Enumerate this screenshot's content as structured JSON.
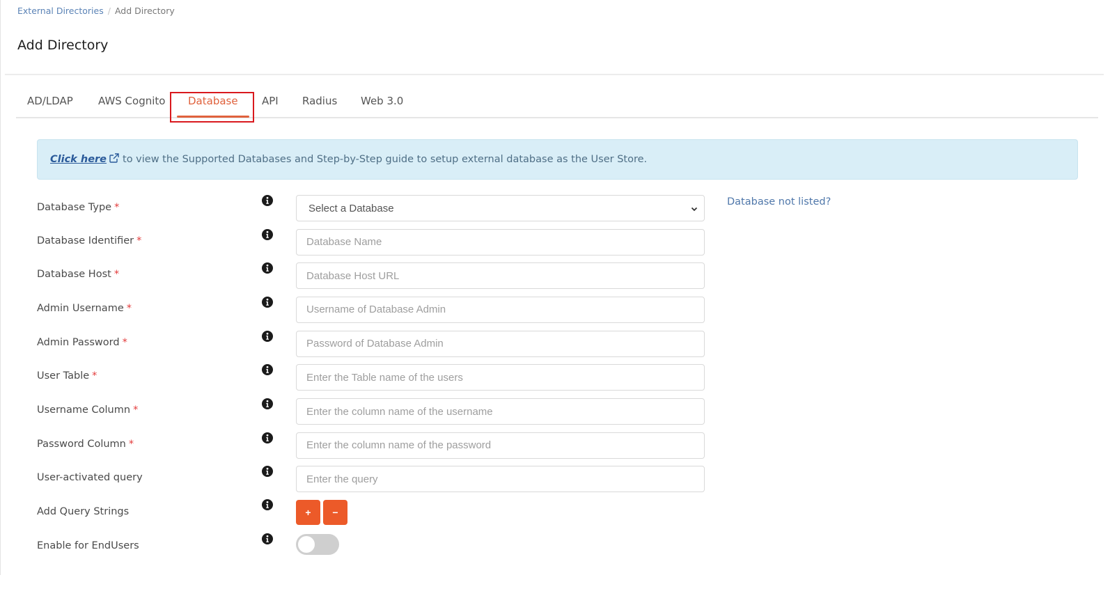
{
  "breadcrumb": {
    "items": [
      {
        "label": "External Directories"
      },
      {
        "label": "Add Directory"
      }
    ],
    "separator": "/"
  },
  "page": {
    "title": "Add Directory"
  },
  "tabs": [
    {
      "label": "AD/LDAP",
      "active": false
    },
    {
      "label": "AWS Cognito",
      "active": false
    },
    {
      "label": "Database",
      "active": true
    },
    {
      "label": "API",
      "active": false
    },
    {
      "label": "Radius",
      "active": false
    },
    {
      "label": "Web 3.0",
      "active": false
    }
  ],
  "banner": {
    "link_label": "Click here",
    "link_icon": "external-link-icon",
    "text": "to view the Supported Databases and Step-by-Step guide to setup external database as the User Store."
  },
  "form": {
    "database_type": {
      "label": "Database Type",
      "required": "*",
      "selected": "Select a Database",
      "side_link": "Database not listed?"
    },
    "fields": [
      {
        "label": "Database Identifier",
        "required": "*",
        "placeholder": "Database Name",
        "value": ""
      },
      {
        "label": "Database Host",
        "required": "*",
        "placeholder": "Database Host URL",
        "value": ""
      },
      {
        "label": "Admin Username",
        "required": "*",
        "placeholder": "Username of Database Admin",
        "value": ""
      },
      {
        "label": "Admin Password",
        "required": "*",
        "placeholder": "Password of Database Admin",
        "value": ""
      },
      {
        "label": "User Table",
        "required": "*",
        "placeholder": "Enter the Table name of the users",
        "value": ""
      },
      {
        "label": "Username Column",
        "required": "*",
        "placeholder": "Enter the column name of the username",
        "value": ""
      },
      {
        "label": "Password Column",
        "required": "*",
        "placeholder": "Enter the column name of the password",
        "value": ""
      },
      {
        "label": "User-activated query",
        "required": "",
        "placeholder": "Enter the query",
        "value": ""
      }
    ],
    "query_strings": {
      "label": "Add Query Strings",
      "add_label": "+",
      "remove_label": "−"
    },
    "enable_endusers": {
      "label": "Enable for EndUsers",
      "enabled": false
    }
  },
  "colors": {
    "accent": "#e0623d",
    "button": "#ec5a29",
    "link": "#4f77aa",
    "banner_bg": "#d9eef7",
    "highlight_box": "#d9191e",
    "required": "#e33b3b"
  }
}
